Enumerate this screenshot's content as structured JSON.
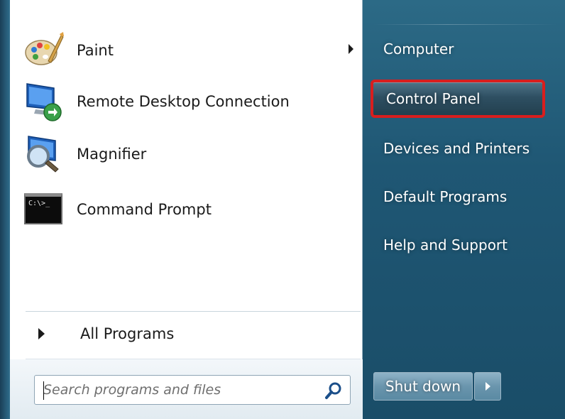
{
  "programs": [
    {
      "label": "Paint",
      "icon": "paint-palette-icon",
      "has_submenu": true
    },
    {
      "label": "Remote Desktop Connection",
      "icon": "remote-desktop-icon",
      "has_submenu": false
    },
    {
      "label": "Magnifier",
      "icon": "magnifier-icon",
      "has_submenu": false
    },
    {
      "label": "Command Prompt",
      "icon": "command-prompt-icon",
      "has_submenu": false
    }
  ],
  "cmd_icon_text": "C:\\>_",
  "all_programs": "All Programs",
  "search": {
    "placeholder": "Search programs and files",
    "value": ""
  },
  "right_items": [
    {
      "label": "Computer",
      "highlighted": false
    },
    {
      "label": "Control Panel",
      "highlighted": true
    },
    {
      "label": "Devices and Printers",
      "highlighted": false
    },
    {
      "label": "Default Programs",
      "highlighted": false
    },
    {
      "label": "Help and Support",
      "highlighted": false
    }
  ],
  "shutdown": {
    "label": "Shut down"
  },
  "colors": {
    "highlight_border": "#d91e1e",
    "pane_blue": "#1f5774"
  }
}
